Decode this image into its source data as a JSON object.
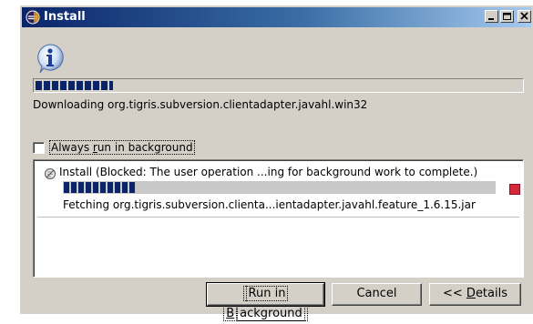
{
  "window": {
    "title": "Install",
    "controls": [
      "minimize",
      "maximize",
      "close"
    ]
  },
  "main": {
    "icon": "info-icon",
    "progress_fraction": 0.16,
    "status_text": "Downloading org.tigris.subversion.clientadapter.javahl.win32"
  },
  "options": {
    "run_in_background_label_pre": "Always ",
    "run_in_background_label_u": "r",
    "run_in_background_label_post": "un in background",
    "run_in_background_checked": false
  },
  "jobs": [
    {
      "name": "Install (Blocked: The user operation ...ing for background work to complete.)",
      "progress_fraction": 0.17,
      "detail": "Fetching org.tigris.subversion.clienta...ientadapter.javahl.feature_1.6.15.jar",
      "stop_color": "#d8283c"
    }
  ],
  "buttons": {
    "run_in_background_pre": "Run in ",
    "run_in_background_u": "B",
    "run_in_background_post": "ackground",
    "cancel": "Cancel",
    "details_pre": "<< ",
    "details_u": "D",
    "details_post": "etails"
  },
  "colors": {
    "title_bar_start": "#0a246a",
    "title_bar_end": "#a6caf0",
    "progress": "#0a246a",
    "dialog_bg": "#d4d0c8"
  }
}
